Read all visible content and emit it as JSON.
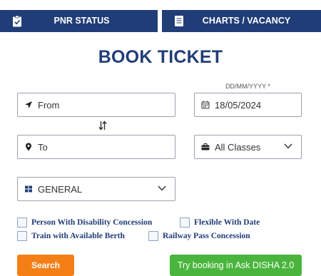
{
  "tabs": {
    "pnr_status": "PNR STATUS",
    "charts_vacancy": "CHARTS / VACANCY"
  },
  "title": "BOOK TICKET",
  "form": {
    "from_label": "From",
    "to_label": "To",
    "date_format_label": "DD/MM/YYYY *",
    "date_value": "18/05/2024",
    "class_value": "All Classes",
    "quota_value": "GENERAL"
  },
  "checkboxes": {
    "disability": "Person With Disability Concession",
    "flexible_date": "Flexible With Date",
    "available_berth": "Train with Available Berth",
    "railway_pass": "Railway Pass Concession"
  },
  "buttons": {
    "search": "Search",
    "disha": "Try booking in Ask DISHA 2.0"
  },
  "colors": {
    "navy": "#213d77",
    "orange": "#f57f17",
    "green": "#49b53c"
  },
  "icons": {
    "pnr": "clipboard-check-icon",
    "charts": "document-list-icon",
    "from": "location-arrow-icon",
    "to": "map-pin-icon",
    "date": "calendar-icon",
    "class": "briefcase-icon",
    "quota": "grid-icon",
    "swap": "swap-arrows-icon",
    "dropdown": "chevron-down-icon"
  }
}
